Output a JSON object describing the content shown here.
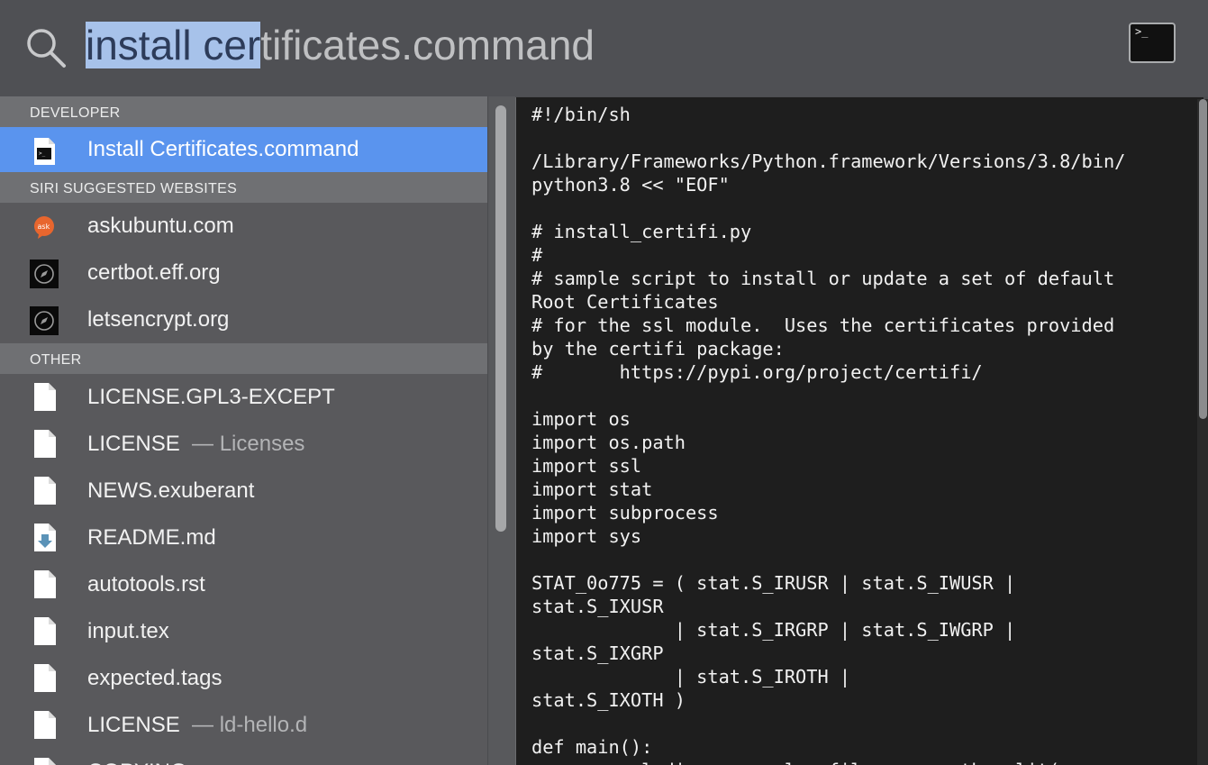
{
  "search": {
    "query_selected": "install cer",
    "query_rest": "tificates.command"
  },
  "sections": [
    {
      "header": "DEVELOPER",
      "items": [
        {
          "label": "Install Certificates.command",
          "sub": "",
          "icon": "terminal-file-icon",
          "selected": true
        }
      ]
    },
    {
      "header": "SIRI SUGGESTED WEBSITES",
      "items": [
        {
          "label": "askubuntu.com",
          "sub": "",
          "icon": "askubuntu-icon"
        },
        {
          "label": "certbot.eff.org",
          "sub": "",
          "icon": "safari-compass-icon"
        },
        {
          "label": "letsencrypt.org",
          "sub": "",
          "icon": "safari-compass-icon"
        }
      ]
    },
    {
      "header": "OTHER",
      "items": [
        {
          "label": "LICENSE.GPL3-EXCEPT",
          "sub": "",
          "icon": "document-icon"
        },
        {
          "label": "LICENSE",
          "sub": "— Licenses",
          "icon": "document-icon"
        },
        {
          "label": "NEWS.exuberant",
          "sub": "",
          "icon": "document-icon"
        },
        {
          "label": "README.md",
          "sub": "",
          "icon": "markdown-file-icon"
        },
        {
          "label": "autotools.rst",
          "sub": "",
          "icon": "document-icon"
        },
        {
          "label": "input.tex",
          "sub": "",
          "icon": "document-icon"
        },
        {
          "label": "expected.tags",
          "sub": "",
          "icon": "document-icon"
        },
        {
          "label": "LICENSE",
          "sub": "— ld-hello.d",
          "icon": "document-icon"
        },
        {
          "label": "COPYING",
          "sub": "",
          "icon": "document-icon"
        }
      ]
    }
  ],
  "preview": {
    "lines": [
      "#!/bin/sh",
      "",
      "/Library/Frameworks/Python.framework/Versions/3.8/bin/",
      "python3.8 << \"EOF\"",
      "",
      "# install_certifi.py",
      "#",
      "# sample script to install or update a set of default",
      "Root Certificates",
      "# for the ssl module.  Uses the certificates provided",
      "by the certifi package:",
      "#       https://pypi.org/project/certifi/",
      "",
      "import os",
      "import os.path",
      "import ssl",
      "import stat",
      "import subprocess",
      "import sys",
      "",
      "STAT_0o775 = ( stat.S_IRUSR | stat.S_IWUSR |",
      "stat.S_IXUSR",
      "             | stat.S_IRGRP | stat.S_IWGRP |",
      "stat.S_IXGRP",
      "             | stat.S_IROTH |",
      "stat.S_IXOTH )",
      "",
      "def main():",
      "    openssl_dir, openssl_cafile = os.path.split("
    ]
  },
  "colors": {
    "selection_blue": "#5a94ee",
    "query_highlight": "#a7c2ea"
  }
}
